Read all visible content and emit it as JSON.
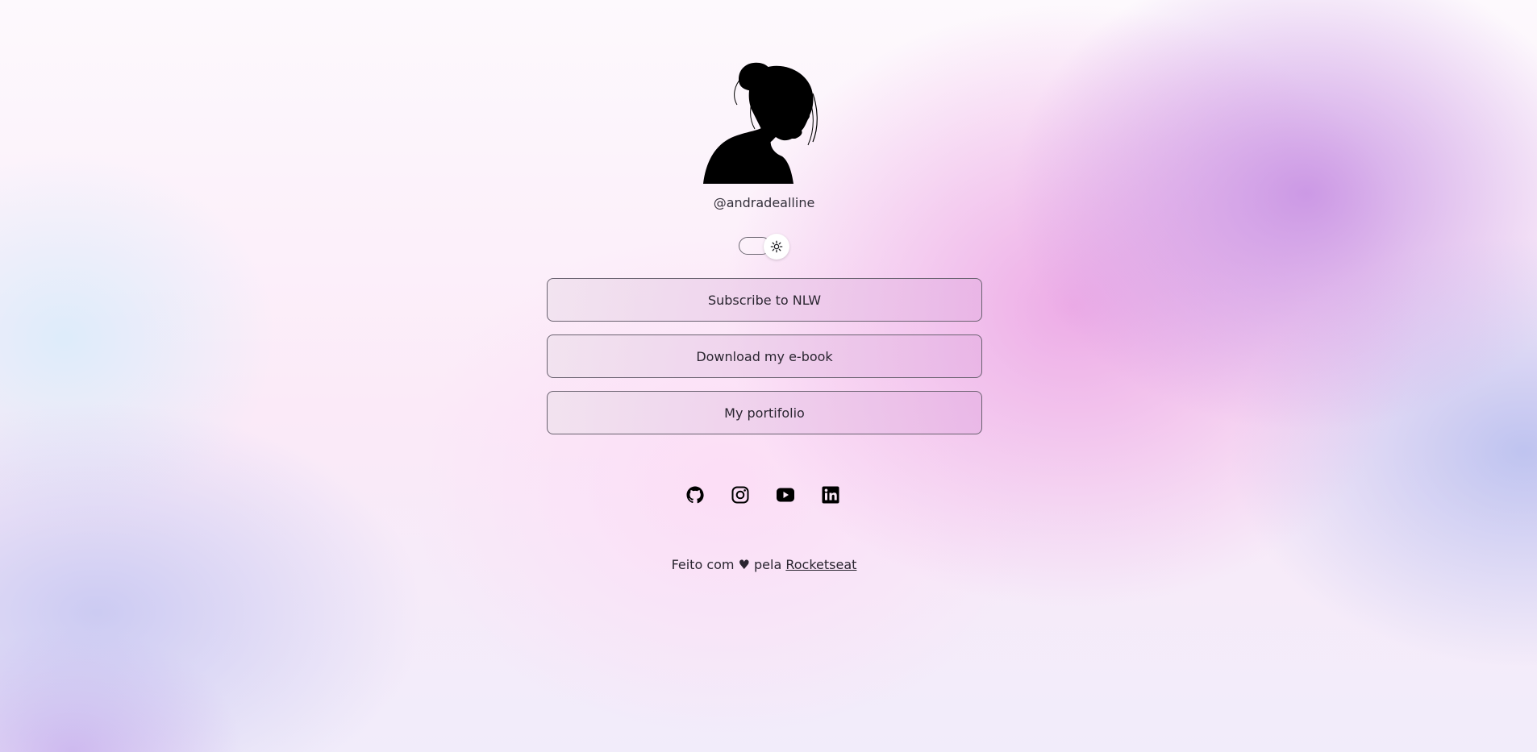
{
  "profile": {
    "image_alt": "silhouette avatar",
    "handle": "@andradealline"
  },
  "theme_switch": {
    "icon": "sun-icon",
    "state": "light"
  },
  "links": [
    {
      "label": "Subscribe to NLW"
    },
    {
      "label": "Download my e-book"
    },
    {
      "label": "My portifolio"
    }
  ],
  "social": [
    {
      "icon": "github-icon"
    },
    {
      "icon": "instagram-icon"
    },
    {
      "icon": "youtube-icon"
    },
    {
      "icon": "linkedin-icon"
    }
  ],
  "footer": {
    "prefix": "Feito com ",
    "heart": "♥",
    "middle": " pela ",
    "link_label": "Rocketseat"
  }
}
